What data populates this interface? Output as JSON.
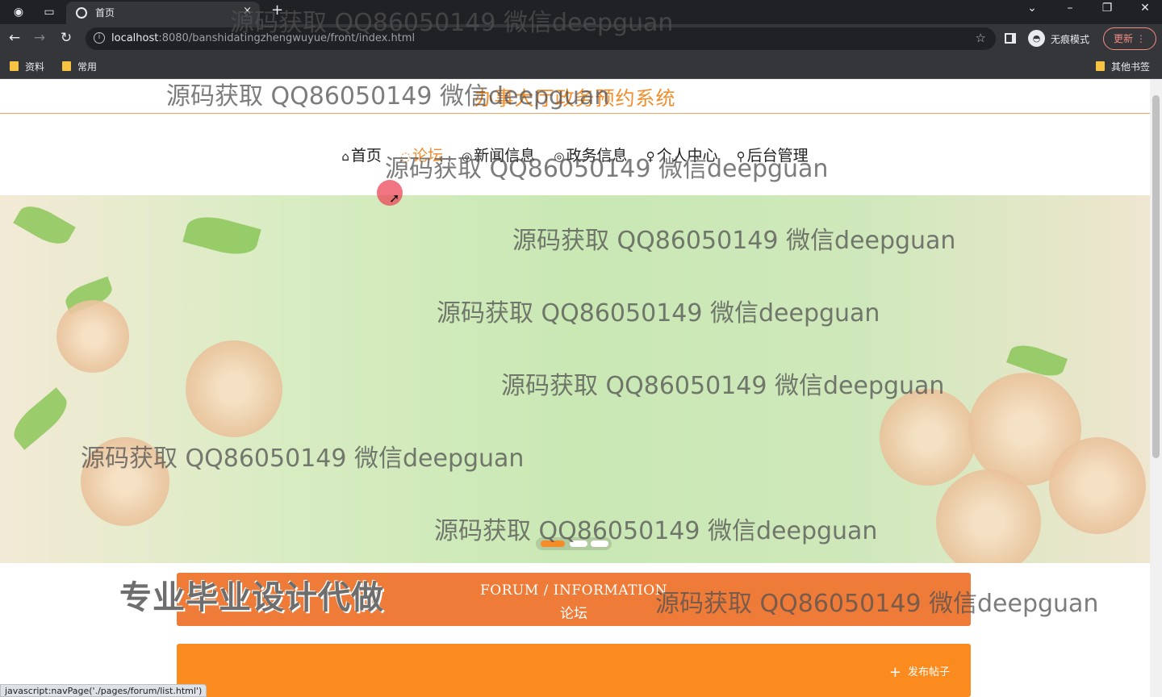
{
  "browser": {
    "tab_title": "首页",
    "tab_close": "×",
    "new_tab": "+",
    "url_host": "localhost",
    "url_rest": ":8080/banshidatingzhengwuyue/front/index.html",
    "incognito_label": "无痕模式",
    "update_label": "更新",
    "bookmarks": [
      "资料",
      "常用"
    ],
    "other_bookmarks": "其他书签",
    "status_url": "javascript:navPage('./pages/forum/list.html')"
  },
  "site": {
    "title": "办事大厅政务预约系统",
    "nav": [
      {
        "icon": "home-icon",
        "glyph": "⌂",
        "label": "首页",
        "active": false
      },
      {
        "icon": "forum-icon",
        "glyph": "◌",
        "label": "论坛",
        "active": true
      },
      {
        "icon": "news-icon",
        "glyph": "◎",
        "label": "新闻信息",
        "active": false
      },
      {
        "icon": "government-icon",
        "glyph": "◎",
        "label": "政务信息",
        "active": false
      },
      {
        "icon": "user-icon",
        "glyph": "♀",
        "label": "个人中心",
        "active": false
      },
      {
        "icon": "link-icon",
        "glyph": "⚲",
        "label": "后台管理",
        "active": false
      }
    ],
    "carousel": {
      "slides": 3,
      "active_index": 0
    },
    "section": {
      "en": "FORUM / INFORMATION",
      "cn": "论坛"
    },
    "post_button": "发布帖子"
  },
  "overlay": {
    "promo": "专业毕业设计代做",
    "watermark": "源码获取 QQ86050149 微信deepguan"
  },
  "colors": {
    "accent": "#f48c2a",
    "section_bg": "#ef7b38",
    "post_bar": "#fb8b1e"
  }
}
